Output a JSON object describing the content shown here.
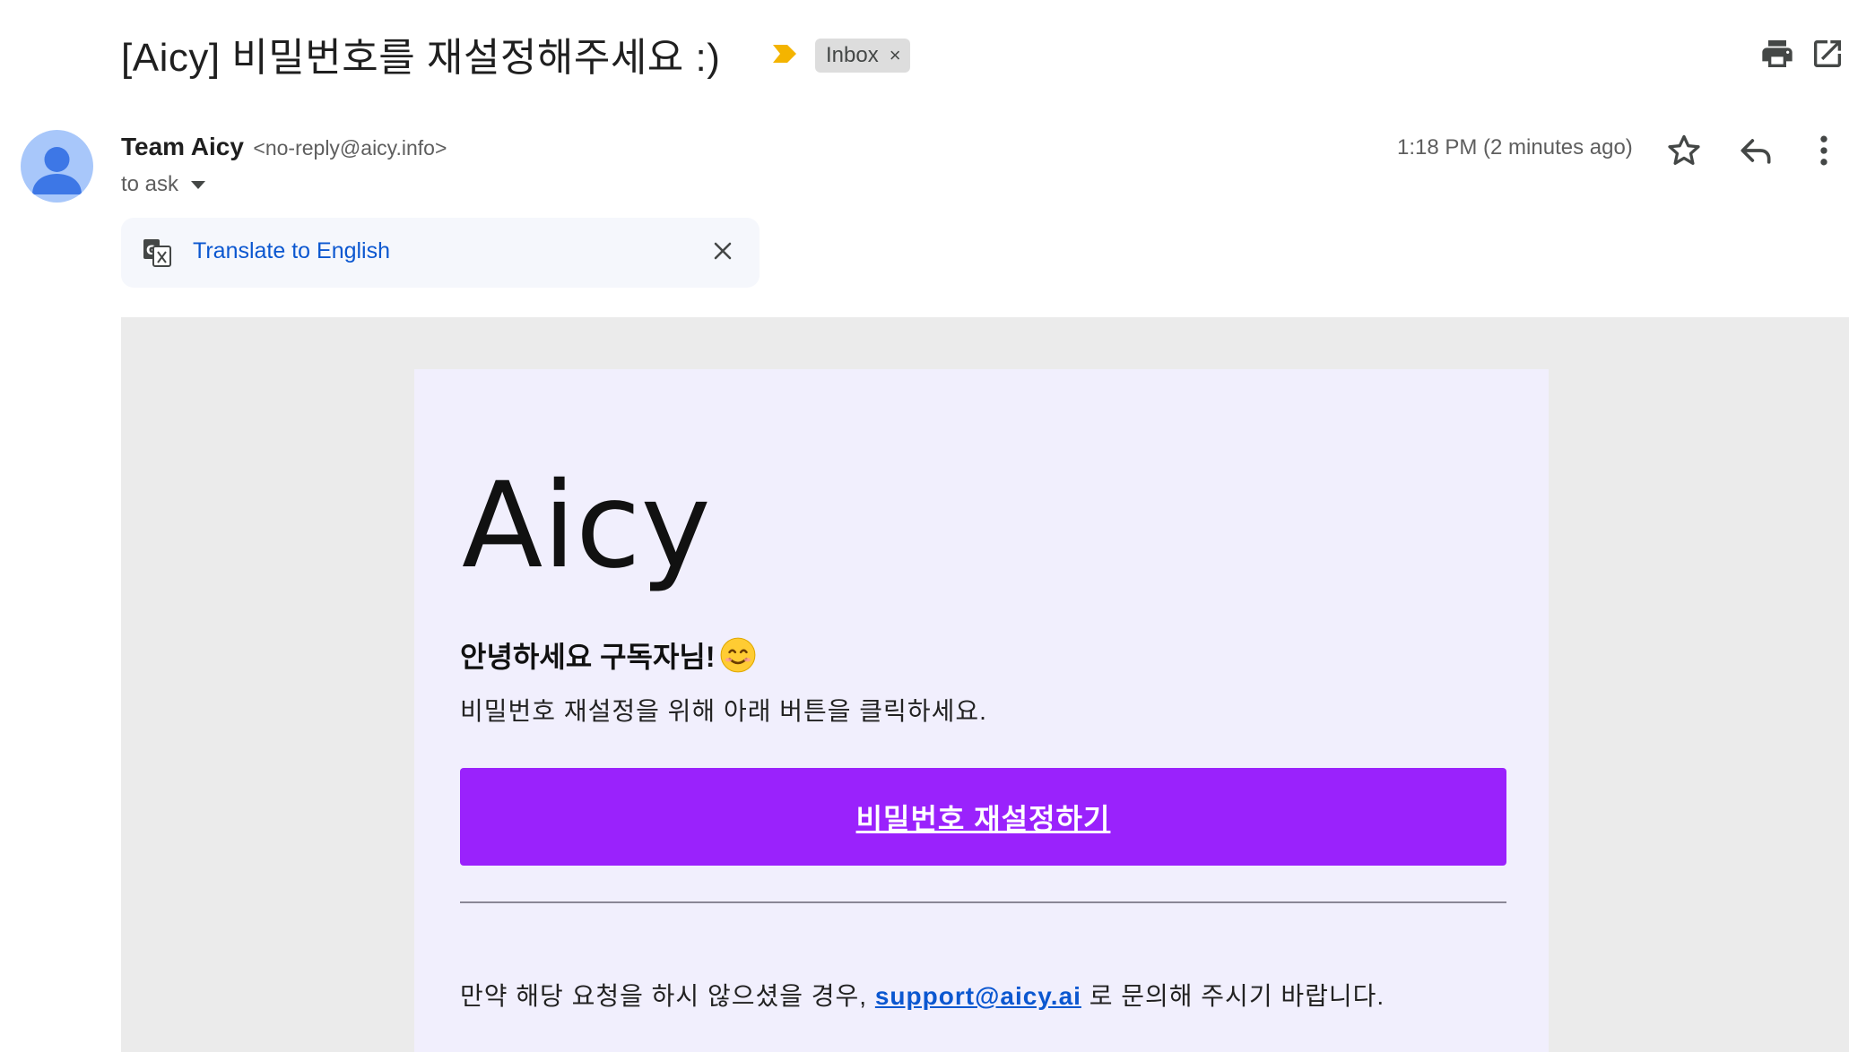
{
  "subject": {
    "text": "[Aicy] 비밀번호를 재설정해주세요 :)",
    "label_chip": "Inbox",
    "label_remove": "×"
  },
  "sender": {
    "name": "Team Aicy",
    "email": "<no-reply@aicy.info>",
    "to": "to ask",
    "time": "1:18 PM (2 minutes ago)"
  },
  "translate": {
    "label": "Translate to English"
  },
  "email": {
    "logo": "Aicy",
    "greeting": "안녕하세요 구독자님!",
    "description": "비밀번호 재설정을 위해 아래 버튼을 클릭하세요.",
    "button_label": "비밀번호 재설정하기",
    "footer_prefix": "만약 해당 요청을 하시 않으셨을 경우,",
    "footer_link": "support@aicy.ai",
    "footer_suffix": "로 문의해 주시기 바랍니다."
  },
  "colors": {
    "accent_button": "#9a22fc",
    "card_background": "#f1effd",
    "link": "#0b57d0",
    "importance_marker": "#f4b400"
  },
  "icons": {
    "importance": "importance-arrow-icon",
    "print": "print-icon",
    "open_new_window": "open-in-new-icon",
    "star": "star-icon",
    "reply": "reply-icon",
    "more": "more-vert-icon",
    "translate": "translate-icon",
    "close": "close-icon",
    "emoji": "smiling-face-icon"
  }
}
